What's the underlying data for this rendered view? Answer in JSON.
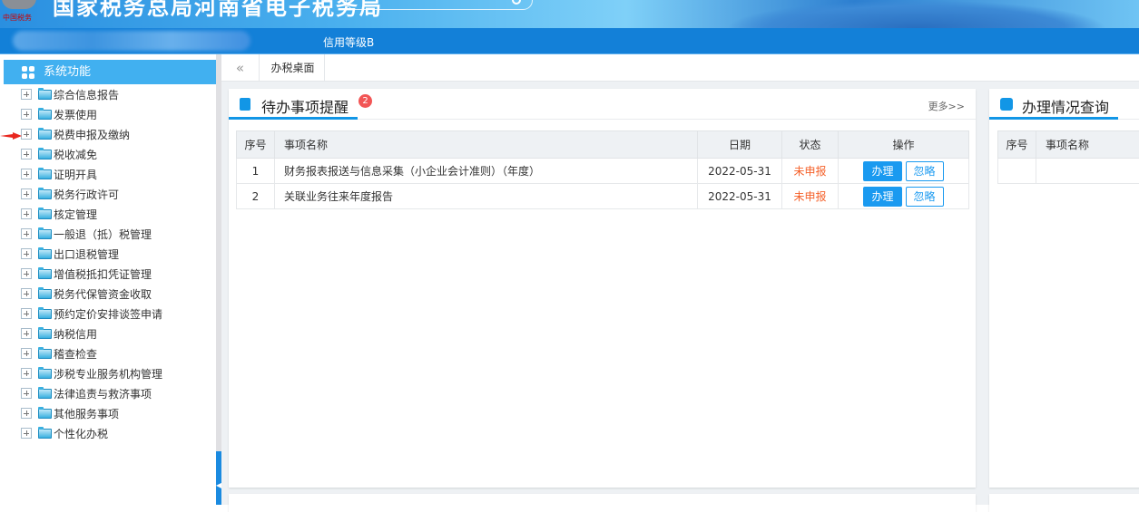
{
  "header": {
    "site_title": "国家税务总局河南省电子税务局",
    "logo_text": "中国税务",
    "search_icon": "search-icon"
  },
  "nav": {
    "credit_level": "信用等级B"
  },
  "sidebar": {
    "title": "系统功能",
    "items": [
      {
        "label": "综合信息报告"
      },
      {
        "label": "发票使用"
      },
      {
        "label": "税费申报及缴纳"
      },
      {
        "label": "税收减免"
      },
      {
        "label": "证明开具"
      },
      {
        "label": "税务行政许可"
      },
      {
        "label": "核定管理"
      },
      {
        "label": "一般退（抵）税管理"
      },
      {
        "label": "出口退税管理"
      },
      {
        "label": "增值税抵扣凭证管理"
      },
      {
        "label": "税务代保管资金收取"
      },
      {
        "label": "预约定价安排谈签申请"
      },
      {
        "label": "纳税信用"
      },
      {
        "label": "稽查检查"
      },
      {
        "label": "涉税专业服务机构管理"
      },
      {
        "label": "法律追责与救济事项"
      },
      {
        "label": "其他服务事项"
      },
      {
        "label": "个性化办税"
      }
    ]
  },
  "tabs": {
    "collapse": "«",
    "active": "办税桌面"
  },
  "todo": {
    "title": "待办事项提醒",
    "badge": "2",
    "more": "更多>>",
    "columns": [
      "序号",
      "事项名称",
      "日期",
      "状态",
      "操作"
    ],
    "rows": [
      {
        "no": "1",
        "name": "财务报表报送与信息采集（小企业会计准则）（年度）",
        "date": "2022-05-31",
        "status": "未申报",
        "action1": "办理",
        "action2": "忽略"
      },
      {
        "no": "2",
        "name": "关联业务往来年度报告",
        "date": "2022-05-31",
        "status": "未申报",
        "action1": "办理",
        "action2": "忽略"
      }
    ]
  },
  "query": {
    "title": "办理情况查询",
    "columns": [
      "序号",
      "事项名称"
    ]
  },
  "colors": {
    "nav": "#1380d8",
    "sidebar_header": "#41b0f0",
    "accent": "#1a9af0",
    "status": "#f5612a",
    "badge": "#f25555"
  }
}
